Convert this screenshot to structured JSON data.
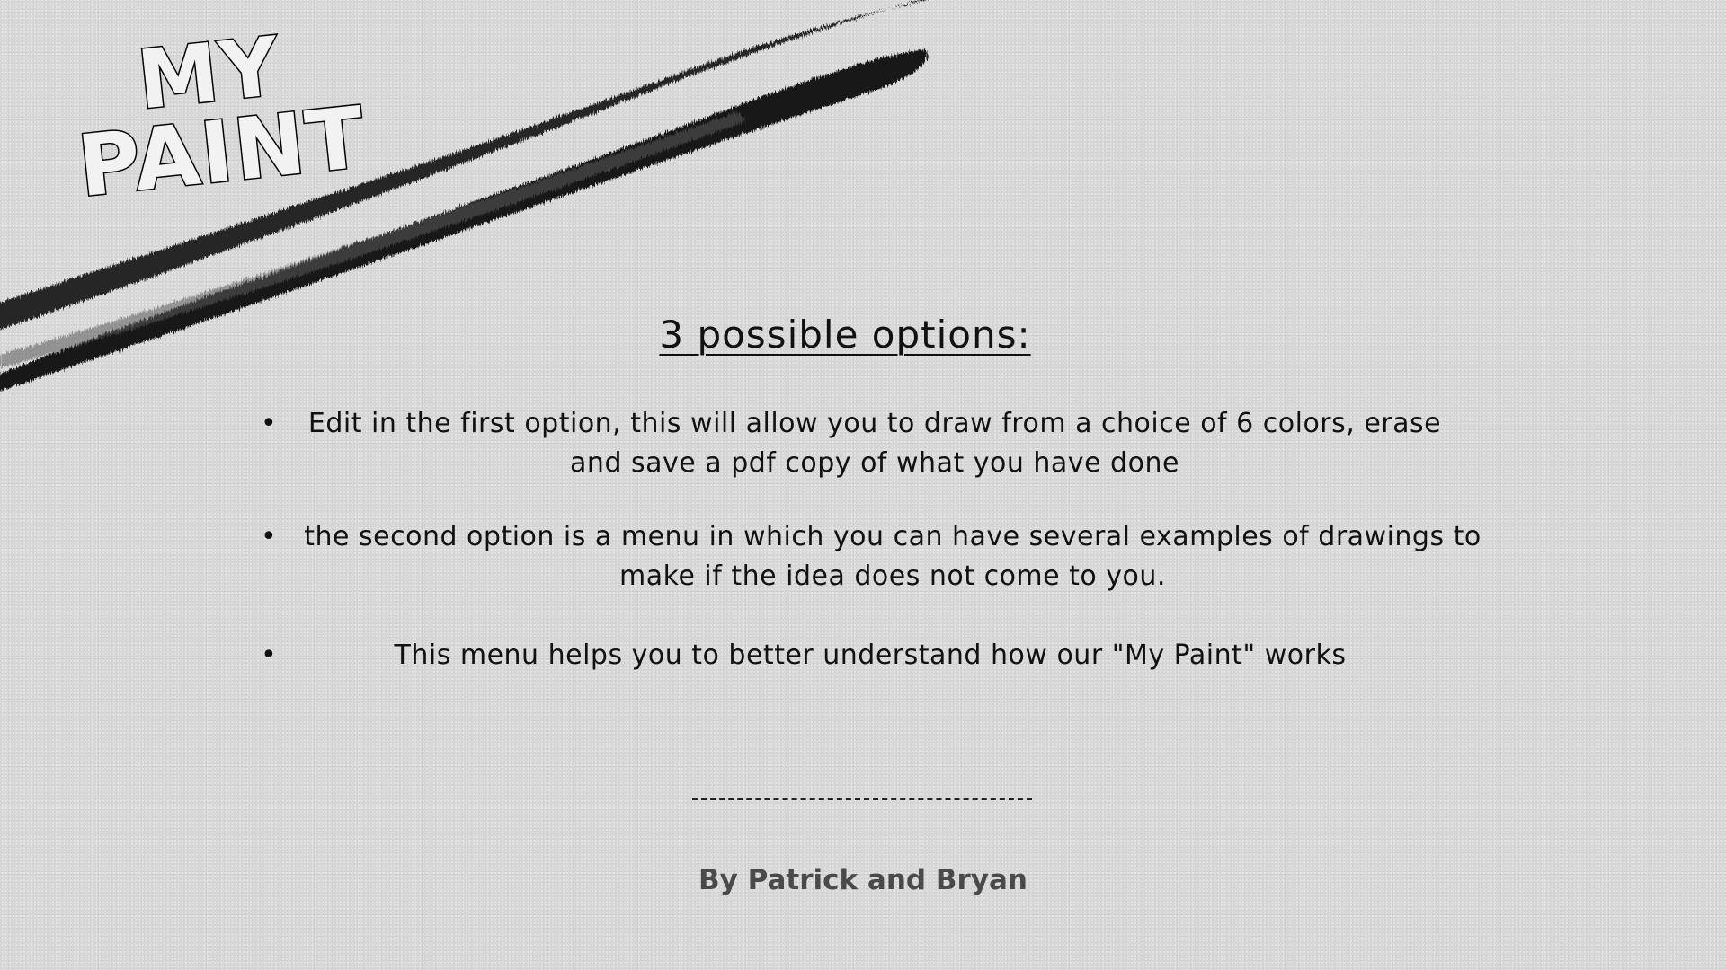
{
  "logo": {
    "line1": "MY",
    "line2": "PAINT"
  },
  "options": {
    "title": "3 possible options:",
    "bullet_symbol": "•",
    "items": [
      {
        "text": "Edit in the first option, this will allow you to draw from a choice of 6 colors, erase and save a pdf copy of what you have done"
      },
      {
        "text": "the second option is a menu in which you can have several examples of drawings to make if the idea does not come to you."
      },
      {
        "text": "This menu helps you to better understand how our \"My Paint\" works"
      }
    ]
  },
  "credits": {
    "text": "By Patrick and Bryan"
  },
  "colors": {
    "background": "#dcdcdc",
    "text": "#111111",
    "credits_text": "#4a4a4a",
    "brush_stroke": "#111111"
  },
  "icons": {
    "brush_stroke": "brush-stroke-decoration",
    "bullet": "bullet-dot"
  }
}
